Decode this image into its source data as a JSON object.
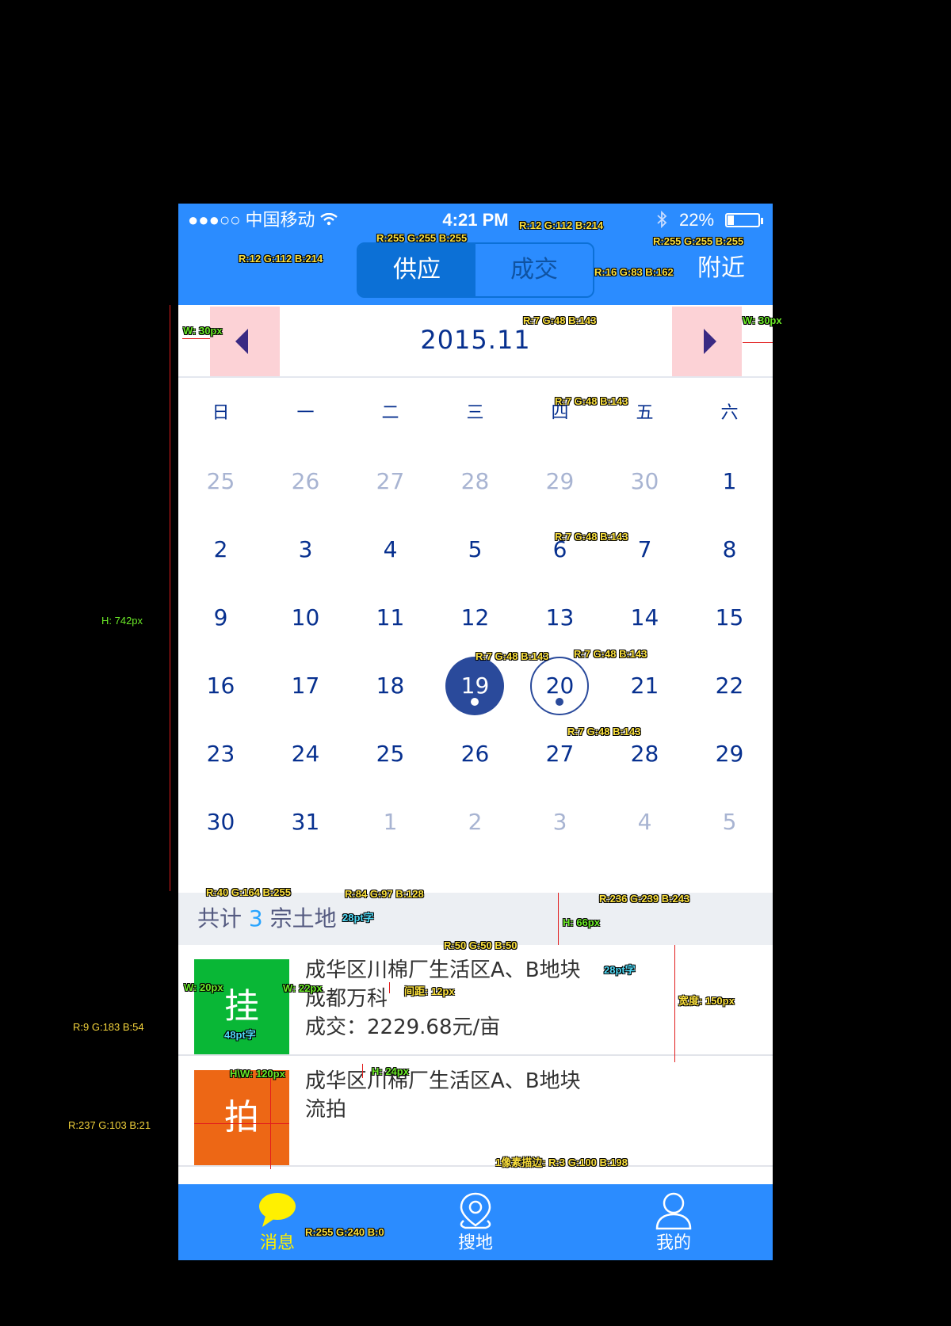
{
  "status_bar": {
    "carrier": "●●●○○ 中国移动",
    "time": "4:21 PM",
    "battery_percent": "22%",
    "battery_level": 0.22,
    "icons": [
      "wifi-icon",
      "bluetooth-icon",
      "battery-icon"
    ]
  },
  "header": {
    "segments": [
      "供应",
      "成交"
    ],
    "active_segment": 0,
    "nearby_label": "附近"
  },
  "month_nav": {
    "title": "2015.11",
    "prev_icon": "triangle-left-icon",
    "next_icon": "triangle-right-icon"
  },
  "calendar": {
    "weekdays": [
      "日",
      "一",
      "二",
      "三",
      "四",
      "五",
      "六"
    ],
    "weeks": [
      [
        {
          "d": "25",
          "dim": true
        },
        {
          "d": "26",
          "dim": true
        },
        {
          "d": "27",
          "dim": true
        },
        {
          "d": "28",
          "dim": true
        },
        {
          "d": "29",
          "dim": true
        },
        {
          "d": "30",
          "dim": true
        },
        {
          "d": "1"
        }
      ],
      [
        {
          "d": "2"
        },
        {
          "d": "3"
        },
        {
          "d": "4"
        },
        {
          "d": "5"
        },
        {
          "d": "6"
        },
        {
          "d": "7"
        },
        {
          "d": "8"
        }
      ],
      [
        {
          "d": "9"
        },
        {
          "d": "10"
        },
        {
          "d": "11"
        },
        {
          "d": "12"
        },
        {
          "d": "13"
        },
        {
          "d": "14"
        },
        {
          "d": "15"
        }
      ],
      [
        {
          "d": "16"
        },
        {
          "d": "17"
        },
        {
          "d": "18"
        },
        {
          "d": "19",
          "state": "selected"
        },
        {
          "d": "20",
          "state": "today"
        },
        {
          "d": "21"
        },
        {
          "d": "22"
        }
      ],
      [
        {
          "d": "23"
        },
        {
          "d": "24"
        },
        {
          "d": "25"
        },
        {
          "d": "26"
        },
        {
          "d": "27"
        },
        {
          "d": "28"
        },
        {
          "d": "29"
        }
      ],
      [
        {
          "d": "30"
        },
        {
          "d": "31"
        },
        {
          "d": "1",
          "dim": true
        },
        {
          "d": "2",
          "dim": true
        },
        {
          "d": "3",
          "dim": true
        },
        {
          "d": "4",
          "dim": true
        },
        {
          "d": "5",
          "dim": true
        }
      ]
    ]
  },
  "summary": {
    "prefix": "共计 ",
    "count": "3",
    "suffix": " 宗土地"
  },
  "listings": [
    {
      "badge": "挂",
      "badge_color": "#09b736",
      "lines": [
        "成华区川棉厂生活区A、B地块",
        "成都万科",
        "成交：2229.68元/亩"
      ]
    },
    {
      "badge": "拍",
      "badge_color": "#ed6715",
      "lines": [
        "成华区川棉厂生活区A、B地块",
        "流拍"
      ]
    }
  ],
  "tabbar": {
    "tabs": [
      {
        "label": "消息",
        "icon": "chat-bubble-icon",
        "active": true
      },
      {
        "label": "搜地",
        "icon": "location-pin-icon",
        "active": false
      },
      {
        "label": "我的",
        "icon": "user-icon",
        "active": false
      }
    ]
  },
  "colors": {
    "header_bg": "#2b8cff",
    "segment_active": "#0c70d6",
    "segment_inactive_text": "#1053a2",
    "calendar_text": "#07308f",
    "selected_circle": "#2a4a9b",
    "summary_bg": "#eceff3",
    "summary_count": "#28a4ff",
    "summary_text": "#545a80",
    "listing_text": "#323232",
    "badge_green": "#09b736",
    "badge_orange": "#ed6715",
    "tab_active": "#fff000",
    "nav_button_bg": "#fcd2d6"
  },
  "annotations": [
    {
      "text": "R:255  G:255  B:255",
      "style": "yellow"
    },
    {
      "text": "R:12  G:112  B:214",
      "style": "yellow"
    },
    {
      "text": "R:12  G:112  B:214",
      "style": "yellow"
    },
    {
      "text": "R:255  G:255  B:255",
      "style": "yellow"
    },
    {
      "text": "R:16  G:83 B:162",
      "style": "yellow"
    },
    {
      "text": "W:  30px",
      "style": "green"
    },
    {
      "text": "R:7  G:48 B:143",
      "style": "yellow"
    },
    {
      "text": "W:  30px",
      "style": "green"
    },
    {
      "text": "R:7  G:48 B:143",
      "style": "yellow"
    },
    {
      "text": "H:  742px",
      "style": "plaingreen"
    },
    {
      "text": "R:7  G:48 B:143",
      "style": "yellow"
    },
    {
      "text": "R:7  G:48 B:143",
      "style": "yellow"
    },
    {
      "text": "R:7  G:48 B:143",
      "style": "yellow"
    },
    {
      "text": "R:7  G:48 B:143",
      "style": "yellow"
    },
    {
      "text": "R:40  G:164  B:255",
      "style": "yellow"
    },
    {
      "text": "R:84  G:97 B:128",
      "style": "yellow"
    },
    {
      "text": "28pt字",
      "style": "cyan"
    },
    {
      "text": "R:236  G:239 B:243",
      "style": "yellow"
    },
    {
      "text": "H:  66px",
      "style": "green"
    },
    {
      "text": "R:50  G:50 B:50",
      "style": "yellow"
    },
    {
      "text": "28pt字",
      "style": "cyan"
    },
    {
      "text": "W:  20px",
      "style": "green"
    },
    {
      "text": "W:  22px",
      "style": "green"
    },
    {
      "text": "间距:  12px",
      "style": "yellow"
    },
    {
      "text": "宽度:  150px",
      "style": "yellow"
    },
    {
      "text": "R:9  G:183  B:54",
      "style": "plain"
    },
    {
      "text": "48pt字",
      "style": "cyan"
    },
    {
      "text": "H\\W:  120px",
      "style": "green"
    },
    {
      "text": "H:  24px",
      "style": "green"
    },
    {
      "text": "R:237  G:103  B:21",
      "style": "plain"
    },
    {
      "text": "1像素描边:  R:3  G:100 B:198",
      "style": "yellow"
    },
    {
      "text": "R:255  G:240 B:0",
      "style": "yellow"
    }
  ]
}
